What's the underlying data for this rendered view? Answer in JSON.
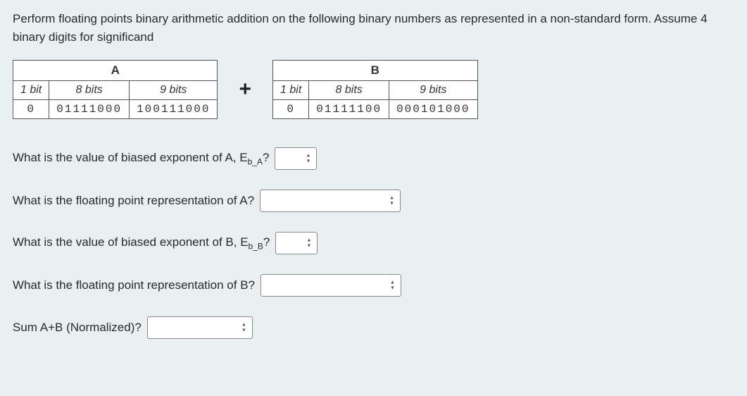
{
  "question": "Perform floating points binary arithmetic addition on the following binary numbers as represented in a non-standard form. Assume 4 binary digits for significand",
  "tableA": {
    "title": "A",
    "headers": [
      "1 bit",
      "8 bits",
      "9 bits"
    ],
    "values": [
      "0",
      "01111000",
      "100111000"
    ]
  },
  "plus": "+",
  "tableB": {
    "title": "B",
    "headers": [
      "1 bit",
      "8 bits",
      "9 bits"
    ],
    "values": [
      "0",
      "01111100",
      "000101000"
    ]
  },
  "q1": {
    "prefix": "What is the value of biased exponent of A, E",
    "sub": "b_A",
    "suffix": "?"
  },
  "q2": "What is the floating point representation of A?",
  "q3": {
    "prefix": "What is the value of biased exponent of B, E",
    "sub": "b_B",
    "suffix": "?"
  },
  "q4": "What is the floating point representation of B?",
  "q5": "Sum A+B (Normalized)?"
}
